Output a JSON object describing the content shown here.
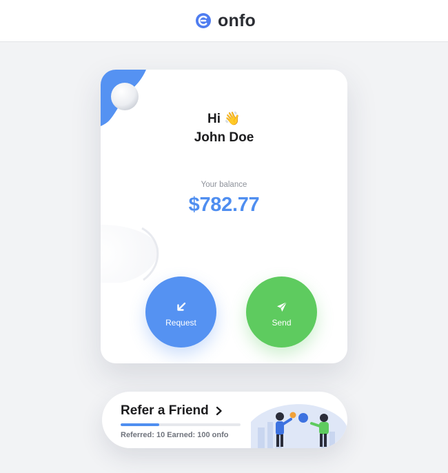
{
  "brand": {
    "name": "onfo",
    "icon": "onfo-logo-icon",
    "color": "#4f7df0"
  },
  "greeting": {
    "line1": "Hi 👋",
    "name": "John Doe"
  },
  "balance": {
    "label": "Your balance",
    "value": "$782.77",
    "color": "#4f8ef0"
  },
  "actions": {
    "request": {
      "label": "Request",
      "icon": "arrow-down-left-icon",
      "color": "#5592f2"
    },
    "send": {
      "label": "Send",
      "icon": "paper-plane-icon",
      "color": "#5ecb5f"
    }
  },
  "refer": {
    "title": "Refer a Friend",
    "stats": "Referred: 10 Earned: 100 onfo",
    "progress": 0.32
  }
}
